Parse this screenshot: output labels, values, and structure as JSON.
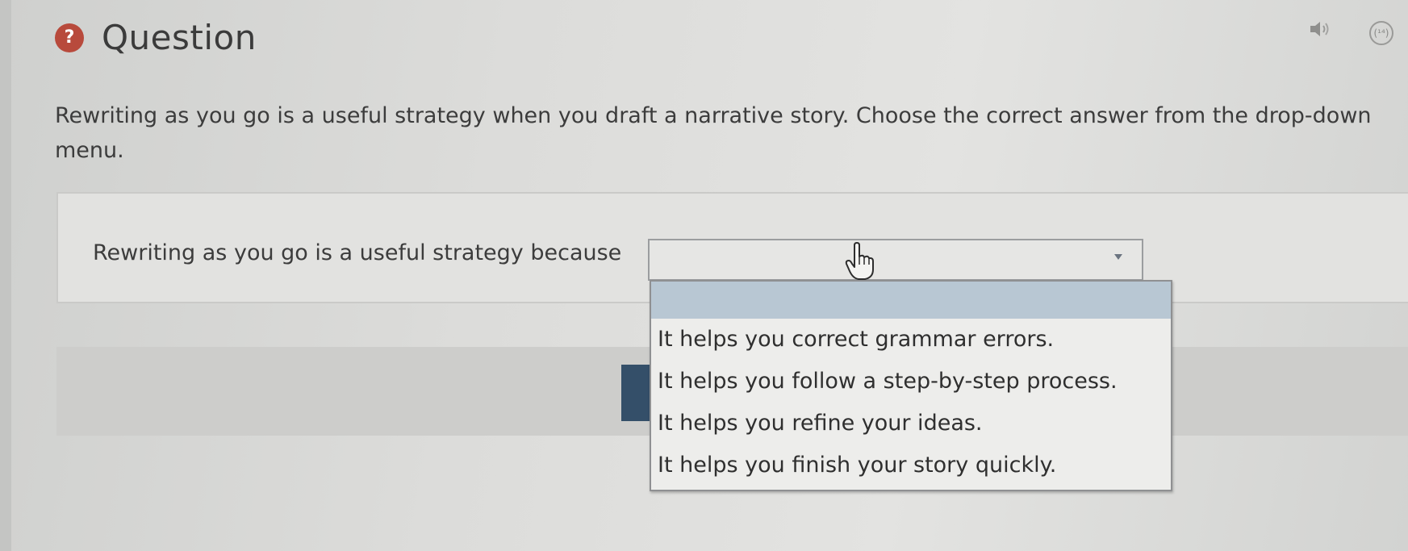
{
  "header": {
    "icon_glyph": "?",
    "title": "Question"
  },
  "toolbar": {
    "speaker_icon": "speaker-icon",
    "counter_label": "(¹⁴)"
  },
  "prompt": {
    "text": "Rewriting as you go is a useful strategy when you draft a narrative story. Choose the correct answer from the drop-down menu."
  },
  "question": {
    "stem": "Rewriting as you go is a useful strategy because",
    "selected_value": ""
  },
  "dropdown": {
    "options": [
      "It helps you correct grammar errors.",
      "It helps you follow a step-by-step process.",
      "It helps you refine your ideas.",
      "It helps you finish your story quickly."
    ]
  },
  "colors": {
    "question_icon": "#b84a3c",
    "button": "#344f69",
    "highlight": "#b8c7d3"
  }
}
